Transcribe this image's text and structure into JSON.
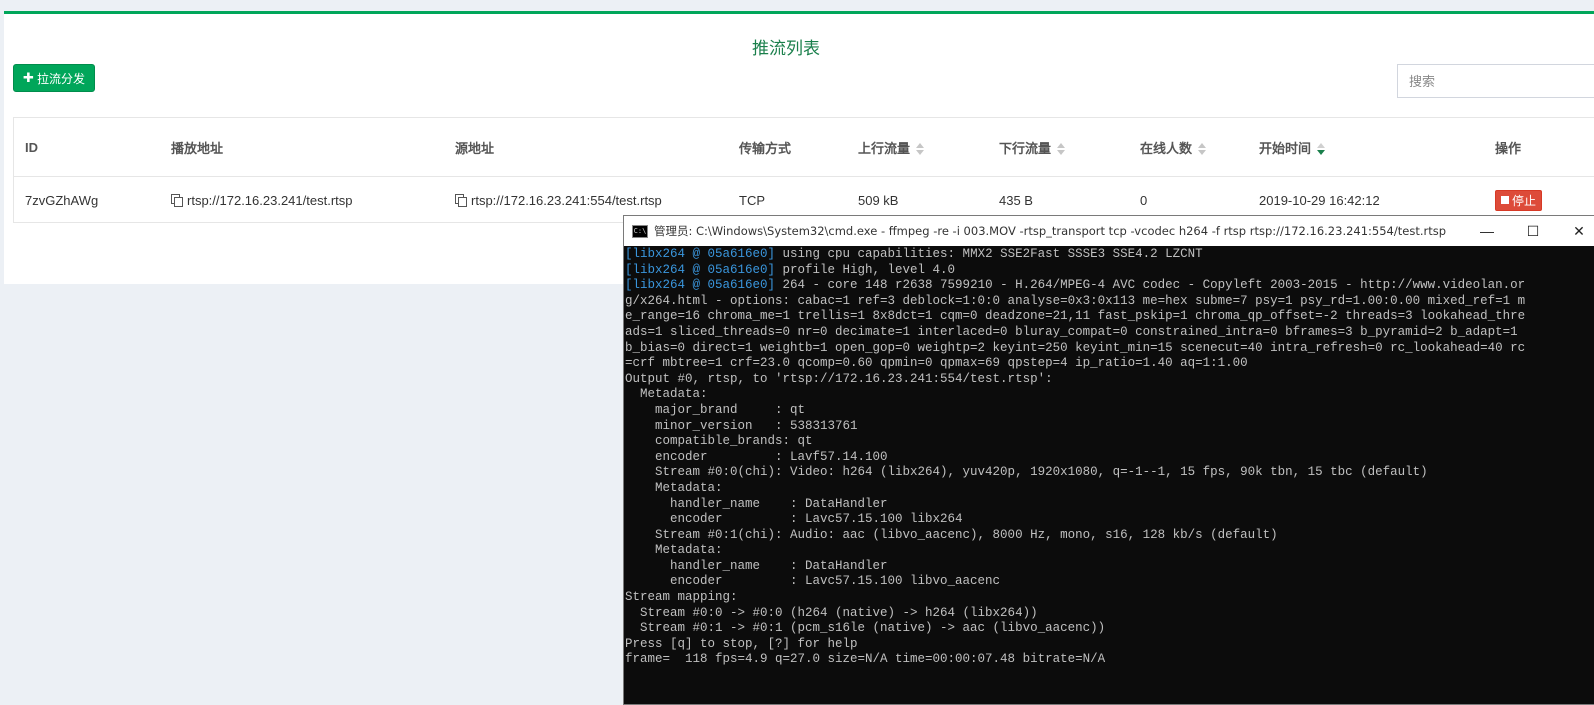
{
  "panel": {
    "title": "推流列表",
    "add_button": "拉流分发",
    "search_placeholder": "搜索"
  },
  "table": {
    "headers": [
      {
        "label": "ID",
        "sortable": false
      },
      {
        "label": "播放地址",
        "sortable": false
      },
      {
        "label": "源地址",
        "sortable": false
      },
      {
        "label": "传输方式",
        "sortable": false
      },
      {
        "label": "上行流量",
        "sortable": true
      },
      {
        "label": "下行流量",
        "sortable": true
      },
      {
        "label": "在线人数",
        "sortable": true
      },
      {
        "label": "开始时间",
        "sortable": true,
        "active": true
      },
      {
        "label": "操作",
        "sortable": false
      }
    ],
    "rows": [
      {
        "id": "7zvGZhAWg",
        "play_url": "rtsp://172.16.23.241/test.rtsp",
        "source_url": "rtsp://172.16.23.241:554/test.rtsp",
        "transport": "TCP",
        "upstream": "509 kB",
        "downstream": "435 B",
        "online": "0",
        "start_time": "2019-10-29 16:42:12",
        "action": "停止"
      }
    ]
  },
  "console": {
    "title": "管理员: C:\\Windows\\System32\\cmd.exe - ffmpeg  -re -i 003.MOV -rtsp_transport tcp -vcodec h264 -f rtsp rtsp://172.16.23.241:554/test.rtsp",
    "icon_text": "C:\\",
    "controls": {
      "minimize": "—",
      "maximize": "☐",
      "close": "✕"
    },
    "lines": [
      {
        "prefix": "[libx264 @ 05a616e0]",
        "text": " using cpu capabilities: MMX2 SSE2Fast SSSE3 SSE4.2 LZCNT"
      },
      {
        "prefix": "[libx264 @ 05a616e0]",
        "text": " profile High, level 4.0"
      },
      {
        "prefix": "[libx264 @ 05a616e0]",
        "text": " 264 - core 148 r2638 7599210 - H.264/MPEG-4 AVC codec - Copyleft 2003-2015 - http://www.videolan.or"
      },
      {
        "prefix": "",
        "text": "g/x264.html - options: cabac=1 ref=3 deblock=1:0:0 analyse=0x3:0x113 me=hex subme=7 psy=1 psy_rd=1.00:0.00 mixed_ref=1 m"
      },
      {
        "prefix": "",
        "text": "e_range=16 chroma_me=1 trellis=1 8x8dct=1 cqm=0 deadzone=21,11 fast_pskip=1 chroma_qp_offset=-2 threads=3 lookahead_thre"
      },
      {
        "prefix": "",
        "text": "ads=1 sliced_threads=0 nr=0 decimate=1 interlaced=0 bluray_compat=0 constrained_intra=0 bframes=3 b_pyramid=2 b_adapt=1"
      },
      {
        "prefix": "",
        "text": "b_bias=0 direct=1 weightb=1 open_gop=0 weightp=2 keyint=250 keyint_min=15 scenecut=40 intra_refresh=0 rc_lookahead=40 rc"
      },
      {
        "prefix": "",
        "text": "=crf mbtree=1 crf=23.0 qcomp=0.60 qpmin=0 qpmax=69 qpstep=4 ip_ratio=1.40 aq=1:1.00"
      },
      {
        "prefix": "",
        "text": "Output #0, rtsp, to 'rtsp://172.16.23.241:554/test.rtsp':"
      },
      {
        "prefix": "",
        "text": "  Metadata:"
      },
      {
        "prefix": "",
        "text": "    major_brand     : qt"
      },
      {
        "prefix": "",
        "text": "    minor_version   : 538313761"
      },
      {
        "prefix": "",
        "text": "    compatible_brands: qt"
      },
      {
        "prefix": "",
        "text": "    encoder         : Lavf57.14.100"
      },
      {
        "prefix": "",
        "text": "    Stream #0:0(chi): Video: h264 (libx264), yuv420p, 1920x1080, q=-1--1, 15 fps, 90k tbn, 15 tbc (default)"
      },
      {
        "prefix": "",
        "text": "    Metadata:"
      },
      {
        "prefix": "",
        "text": "      handler_name    : DataHandler"
      },
      {
        "prefix": "",
        "text": "      encoder         : Lavc57.15.100 libx264"
      },
      {
        "prefix": "",
        "text": "    Stream #0:1(chi): Audio: aac (libvo_aacenc), 8000 Hz, mono, s16, 128 kb/s (default)"
      },
      {
        "prefix": "",
        "text": "    Metadata:"
      },
      {
        "prefix": "",
        "text": "      handler_name    : DataHandler"
      },
      {
        "prefix": "",
        "text": "      encoder         : Lavc57.15.100 libvo_aacenc"
      },
      {
        "prefix": "",
        "text": "Stream mapping:"
      },
      {
        "prefix": "",
        "text": "  Stream #0:0 -> #0:0 (h264 (native) -> h264 (libx264))"
      },
      {
        "prefix": "",
        "text": "  Stream #0:1 -> #0:1 (pcm_s16le (native) -> aac (libvo_aacenc))"
      },
      {
        "prefix": "",
        "text": "Press [q] to stop, [?] for help"
      },
      {
        "prefix": "",
        "text": "frame=  118 fps=4.9 q=27.0 size=N/A time=00:00:07.48 bitrate=N/A"
      }
    ]
  }
}
